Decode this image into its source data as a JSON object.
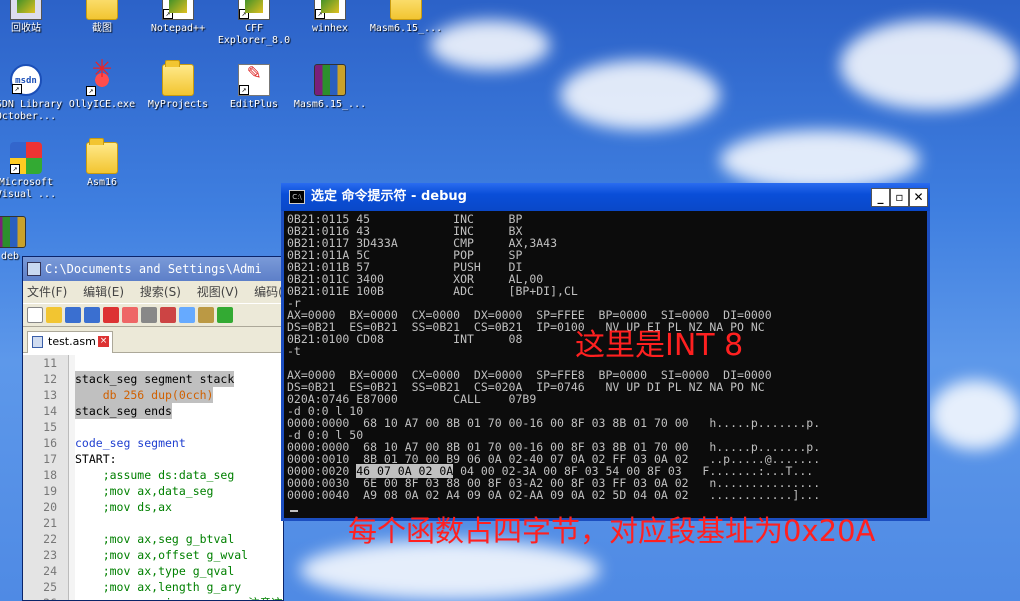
{
  "desktop": {
    "icons": [
      {
        "label": "回收站",
        "icon": "recycle-bin-icon"
      },
      {
        "label": "截图",
        "icon": "folder-icon"
      },
      {
        "label": "Notepad++",
        "icon": "notepad-plus-plus-icon"
      },
      {
        "label": "CFF Explorer_8.0",
        "icon": "cff-explorer-icon"
      },
      {
        "label": "winhex",
        "icon": "winhex-icon"
      },
      {
        "label": "Masm6.15_...",
        "icon": "folder-icon"
      },
      {
        "label": "MSDN Library October...",
        "icon": "msdn-icon"
      },
      {
        "label": "OllyICE.exe",
        "icon": "ollyice-icon"
      },
      {
        "label": "MyProjects",
        "icon": "folder-icon"
      },
      {
        "label": "EditPlus",
        "icon": "editplus-icon"
      },
      {
        "label": "Masm6.15_...",
        "icon": "winrar-icon"
      },
      {
        "label": "Microsoft Visual ...",
        "icon": "visual-studio-icon"
      },
      {
        "label": "Asm16",
        "icon": "folder-icon"
      },
      {
        "label": "deb",
        "icon": "winrar-icon"
      }
    ]
  },
  "notepad": {
    "title": "C:\\Documents and Settings\\Admi",
    "menu": [
      "文件(F)",
      "编辑(E)",
      "搜索(S)",
      "视图(V)",
      "编码(N"
    ],
    "tab_label": "test.asm",
    "lines": [
      {
        "n": "11",
        "t": ""
      },
      {
        "n": "12",
        "t": "stack_seg segment stack"
      },
      {
        "n": "13",
        "t": "    db 256 dup(0cch)"
      },
      {
        "n": "14",
        "t": "stack_seg ends"
      },
      {
        "n": "15",
        "t": ""
      },
      {
        "n": "16",
        "t": "code_seg segment"
      },
      {
        "n": "17",
        "t": "START:"
      },
      {
        "n": "18",
        "t": "    ;assume ds:data_seg"
      },
      {
        "n": "19",
        "t": "    ;mov ax,data_seg"
      },
      {
        "n": "20",
        "t": "    ;mov ds,ax"
      },
      {
        "n": "21",
        "t": ""
      },
      {
        "n": "22",
        "t": "    ;mov ax,seg g_btval"
      },
      {
        "n": "23",
        "t": "    ;mov ax,offset g_wval"
      },
      {
        "n": "24",
        "t": "    ;mov ax,type g_qval"
      },
      {
        "n": "25",
        "t": "    ;mov ax,length g_ary"
      },
      {
        "n": "26",
        "t": "    ;mov ax,size g_ary  ;注意这里的语法是 size 而不是 length"
      }
    ]
  },
  "console": {
    "title": "选定 命令提示符 - debug",
    "lines": [
      "0B21:0115 45            INC     BP",
      "0B21:0116 43            INC     BX",
      "0B21:0117 3D433A        CMP     AX,3A43",
      "0B21:011A 5C            POP     SP",
      "0B21:011B 57            PUSH    DI",
      "0B21:011C 3400          XOR     AL,00",
      "0B21:011E 100B          ADC     [BP+DI],CL",
      "-r",
      "AX=0000  BX=0000  CX=0000  DX=0000  SP=FFEE  BP=0000  SI=0000  DI=0000",
      "DS=0B21  ES=0B21  SS=0B21  CS=0B21  IP=0100   NV UP EI PL NZ NA PO NC",
      "0B21:0100 CD08          INT     08",
      "-t",
      "",
      "AX=0000  BX=0000  CX=0000  DX=0000  SP=FFE8  BP=0000  SI=0000  DI=0000",
      "DS=0B21  ES=0B21  SS=0B21  CS=020A  IP=0746   NV UP DI PL NZ NA PO NC",
      "020A:0746 E87000        CALL    07B9",
      "-d 0:0 l 10",
      "0000:0000  68 10 A7 00 8B 01 70 00-16 00 8F 03 8B 01 70 00   h.....p.......p.",
      "-d 0:0 l 50",
      "0000:0000  68 10 A7 00 8B 01 70 00-16 00 8F 03 8B 01 70 00   h.....p.......p.",
      "0000:0010  8B 01 70 00 B9 06 0A 02-40 07 0A 02 FF 03 0A 02   ..p.....@.......",
      "0000:0020  46 07 0A 02 0A 04 00 02-3A 00 8F 03 54 00 8F 03   F.......:...T...",
      "0000:0030  6E 00 8F 03 88 00 8F 03-A2 00 8F 03 FF 03 0A 02   n...............",
      "0000:0040  A9 08 0A 02 A4 09 0A 02-AA 09 0A 02 5D 04 0A 02   ............]..."
    ],
    "highlight_text": "46 07 0A 02 0A",
    "line_0020_prefix": "0000:0020 ",
    "line_0020_rest": " 04 00 02-3A 00 8F 03 54 00 8F 03   F.......:...T..."
  },
  "annotations": {
    "int8": "这里是INT 8",
    "segment_note": "每个函数占四字节，对应段基址为0x20A",
    "color": "#ff2020"
  }
}
